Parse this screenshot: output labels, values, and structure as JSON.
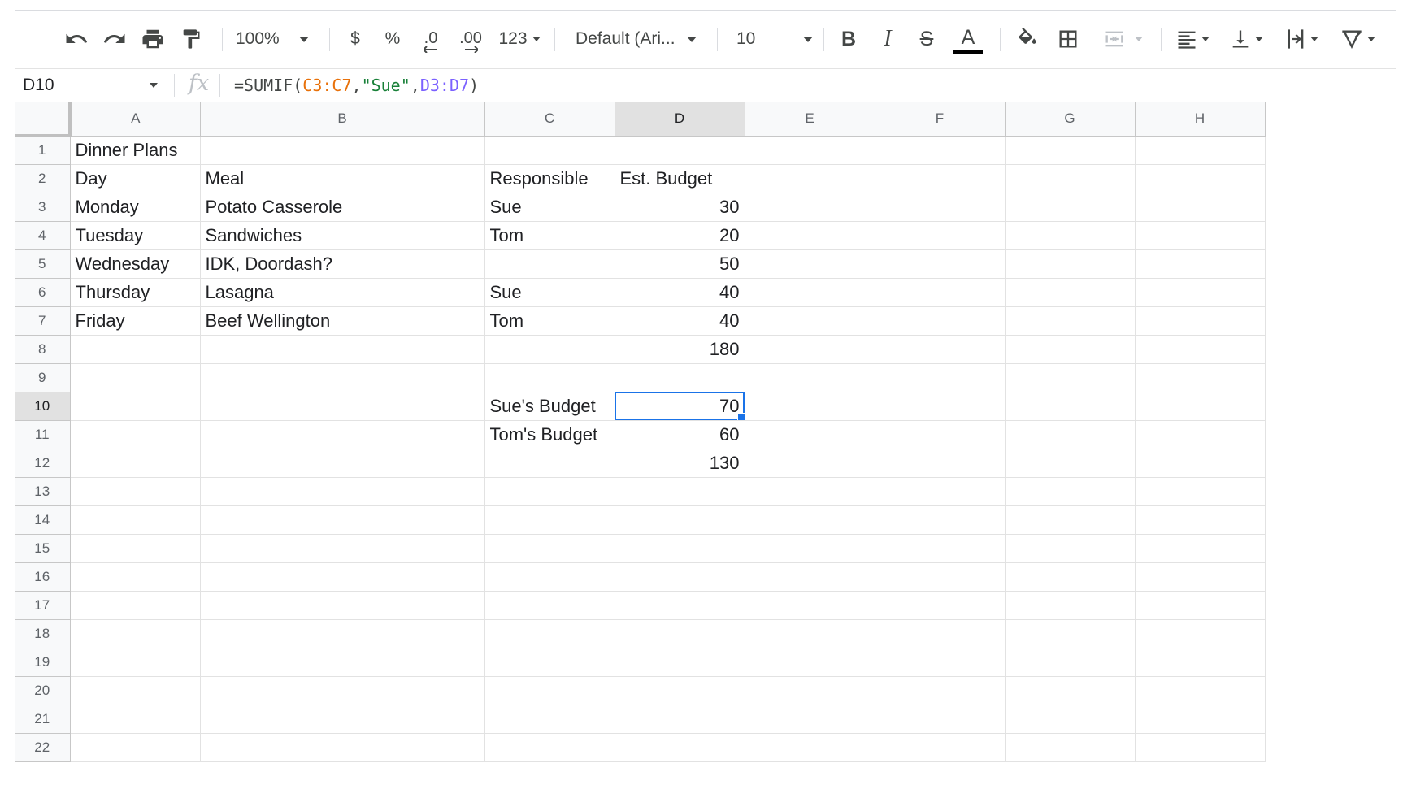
{
  "toolbar": {
    "zoom": "100%",
    "currency": "$",
    "percent": "%",
    "decrease_decimal": ".0",
    "increase_decimal": ".00",
    "more_formats": "123",
    "font_family": "Default (Ari...",
    "font_size": "10",
    "bold": "B",
    "italic": "I",
    "strikethrough": "S",
    "text_color_letter": "A",
    "text_color": "#000000"
  },
  "formula_bar": {
    "name_box": "D10",
    "fx": "fx",
    "formula_prefix": "=SUMIF(",
    "ref1": "C3:C7",
    "comma1": ",",
    "criterion": "\"Sue\"",
    "comma2": ",",
    "ref2": "D3:D7",
    "formula_suffix": ")"
  },
  "sheet": {
    "columns": [
      "A",
      "B",
      "C",
      "D",
      "E",
      "F",
      "G",
      "H"
    ],
    "active_cell": "D10",
    "rows": [
      {
        "num": "1",
        "cells": [
          "Dinner Plans",
          "",
          "",
          "",
          "",
          "",
          "",
          ""
        ]
      },
      {
        "num": "2",
        "cells": [
          "Day",
          "Meal",
          "Responsible",
          "Est. Budget",
          "",
          "",
          "",
          ""
        ]
      },
      {
        "num": "3",
        "cells": [
          "Monday",
          "Potato Casserole",
          "Sue",
          "30",
          "",
          "",
          "",
          ""
        ]
      },
      {
        "num": "4",
        "cells": [
          "Tuesday",
          "Sandwiches",
          "Tom",
          "20",
          "",
          "",
          "",
          ""
        ]
      },
      {
        "num": "5",
        "cells": [
          "Wednesday",
          "IDK, Doordash?",
          "",
          "50",
          "",
          "",
          "",
          ""
        ]
      },
      {
        "num": "6",
        "cells": [
          "Thursday",
          "Lasagna",
          "Sue",
          "40",
          "",
          "",
          "",
          ""
        ]
      },
      {
        "num": "7",
        "cells": [
          "Friday",
          "Beef Wellington",
          "Tom",
          "40",
          "",
          "",
          "",
          ""
        ]
      },
      {
        "num": "8",
        "cells": [
          "",
          "",
          "",
          "180",
          "",
          "",
          "",
          ""
        ]
      },
      {
        "num": "9",
        "cells": [
          "",
          "",
          "",
          "",
          "",
          "",
          "",
          ""
        ]
      },
      {
        "num": "10",
        "cells": [
          "",
          "",
          "Sue's Budget",
          "70",
          "",
          "",
          "",
          ""
        ]
      },
      {
        "num": "11",
        "cells": [
          "",
          "",
          "Tom's Budget",
          "60",
          "",
          "",
          "",
          ""
        ]
      },
      {
        "num": "12",
        "cells": [
          "",
          "",
          "",
          "130",
          "",
          "",
          "",
          ""
        ]
      },
      {
        "num": "13",
        "cells": [
          "",
          "",
          "",
          "",
          "",
          "",
          "",
          ""
        ]
      },
      {
        "num": "14",
        "cells": [
          "",
          "",
          "",
          "",
          "",
          "",
          "",
          ""
        ]
      },
      {
        "num": "15",
        "cells": [
          "",
          "",
          "",
          "",
          "",
          "",
          "",
          ""
        ]
      },
      {
        "num": "16",
        "cells": [
          "",
          "",
          "",
          "",
          "",
          "",
          "",
          ""
        ]
      },
      {
        "num": "17",
        "cells": [
          "",
          "",
          "",
          "",
          "",
          "",
          "",
          ""
        ]
      },
      {
        "num": "18",
        "cells": [
          "",
          "",
          "",
          "",
          "",
          "",
          "",
          ""
        ]
      },
      {
        "num": "19",
        "cells": [
          "",
          "",
          "",
          "",
          "",
          "",
          "",
          ""
        ]
      },
      {
        "num": "20",
        "cells": [
          "",
          "",
          "",
          "",
          "",
          "",
          "",
          ""
        ]
      },
      {
        "num": "21",
        "cells": [
          "",
          "",
          "",
          "",
          "",
          "",
          "",
          ""
        ]
      },
      {
        "num": "22",
        "cells": [
          "",
          "",
          "",
          "",
          "",
          "",
          "",
          ""
        ]
      }
    ]
  }
}
